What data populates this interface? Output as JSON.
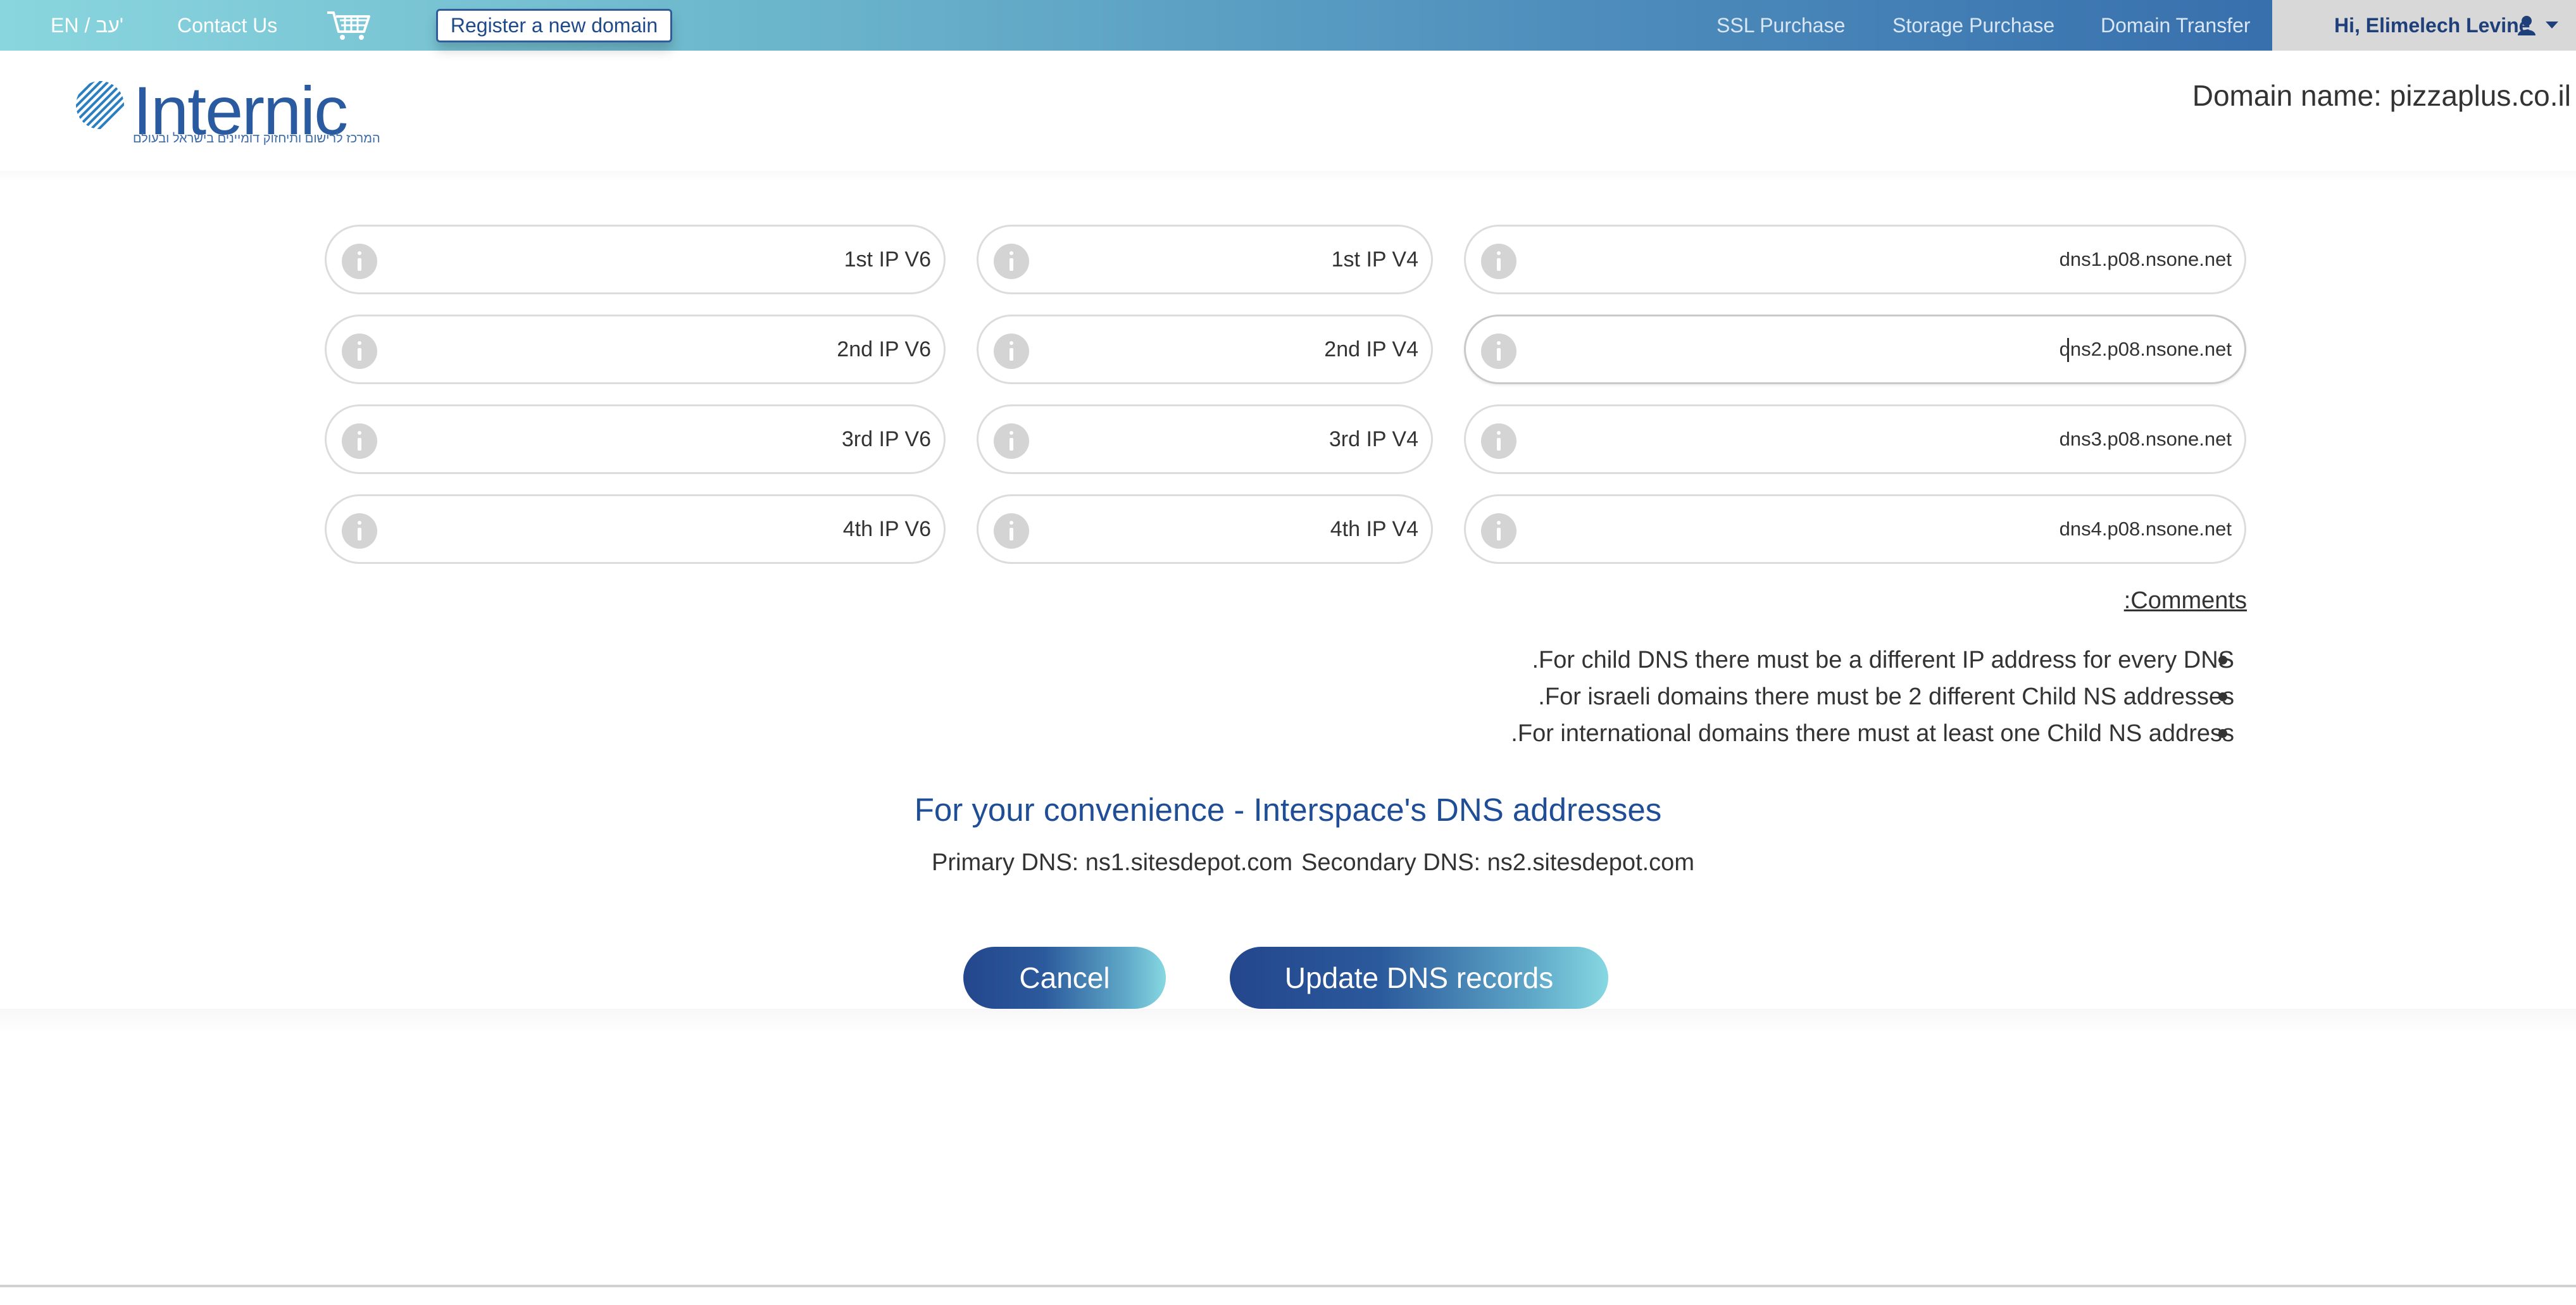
{
  "topbar": {
    "language": "EN / עב'",
    "contact": "Contact Us",
    "cart_icon": "shopping-cart-icon",
    "register_button": "Register a new domain",
    "ssl": "SSL Purchase",
    "storage": "Storage Purchase",
    "transfer": "Domain Transfer",
    "user_greeting": "Hi, Elimelech Levine",
    "user_icon": "user-icon",
    "caret_icon": "chevron-down-icon"
  },
  "header": {
    "logo_text": "Internic",
    "logo_subtitle": "המרכז לרישום ותיחזוק דומיינים בישראל ובעולם",
    "domain_name": "Domain name: pizzaplus.co.il"
  },
  "dns_records": [
    {
      "dns": "dns1.p08.nsone.net",
      "ipv4": "1st IP V4",
      "ipv6": "1st IP V6"
    },
    {
      "dns": "dns2.p08.nsone.net",
      "ipv4": "2nd IP V4",
      "ipv6": "2nd IP V6"
    },
    {
      "dns": "dns3.p08.nsone.net",
      "ipv4": "3rd IP V4",
      "ipv6": "3rd IP V6"
    },
    {
      "dns": "dns4.p08.nsone.net",
      "ipv4": "4th IP V4",
      "ipv6": "4th IP V6"
    }
  ],
  "comments": {
    "title": ":Comments",
    "items": [
      ".For child DNS there must be a different IP address for every DNS",
      ".For israeli domains there must be 2 different Child NS addresses",
      ".For international domains there must at least one Child NS address"
    ]
  },
  "convenience": {
    "title": "For your convenience - Interspace's DNS addresses",
    "primary": "Primary DNS: ns1.sitesdepot.com",
    "secondary": "Secondary DNS: ns2.sitesdepot.com"
  },
  "actions": {
    "cancel": "Cancel",
    "update": "Update DNS records"
  },
  "colors": {
    "brand": "#2a5aa0",
    "title_blue": "#1f4e96",
    "topbar_start": "#8ad6de",
    "topbar_end": "#2e62a6"
  }
}
